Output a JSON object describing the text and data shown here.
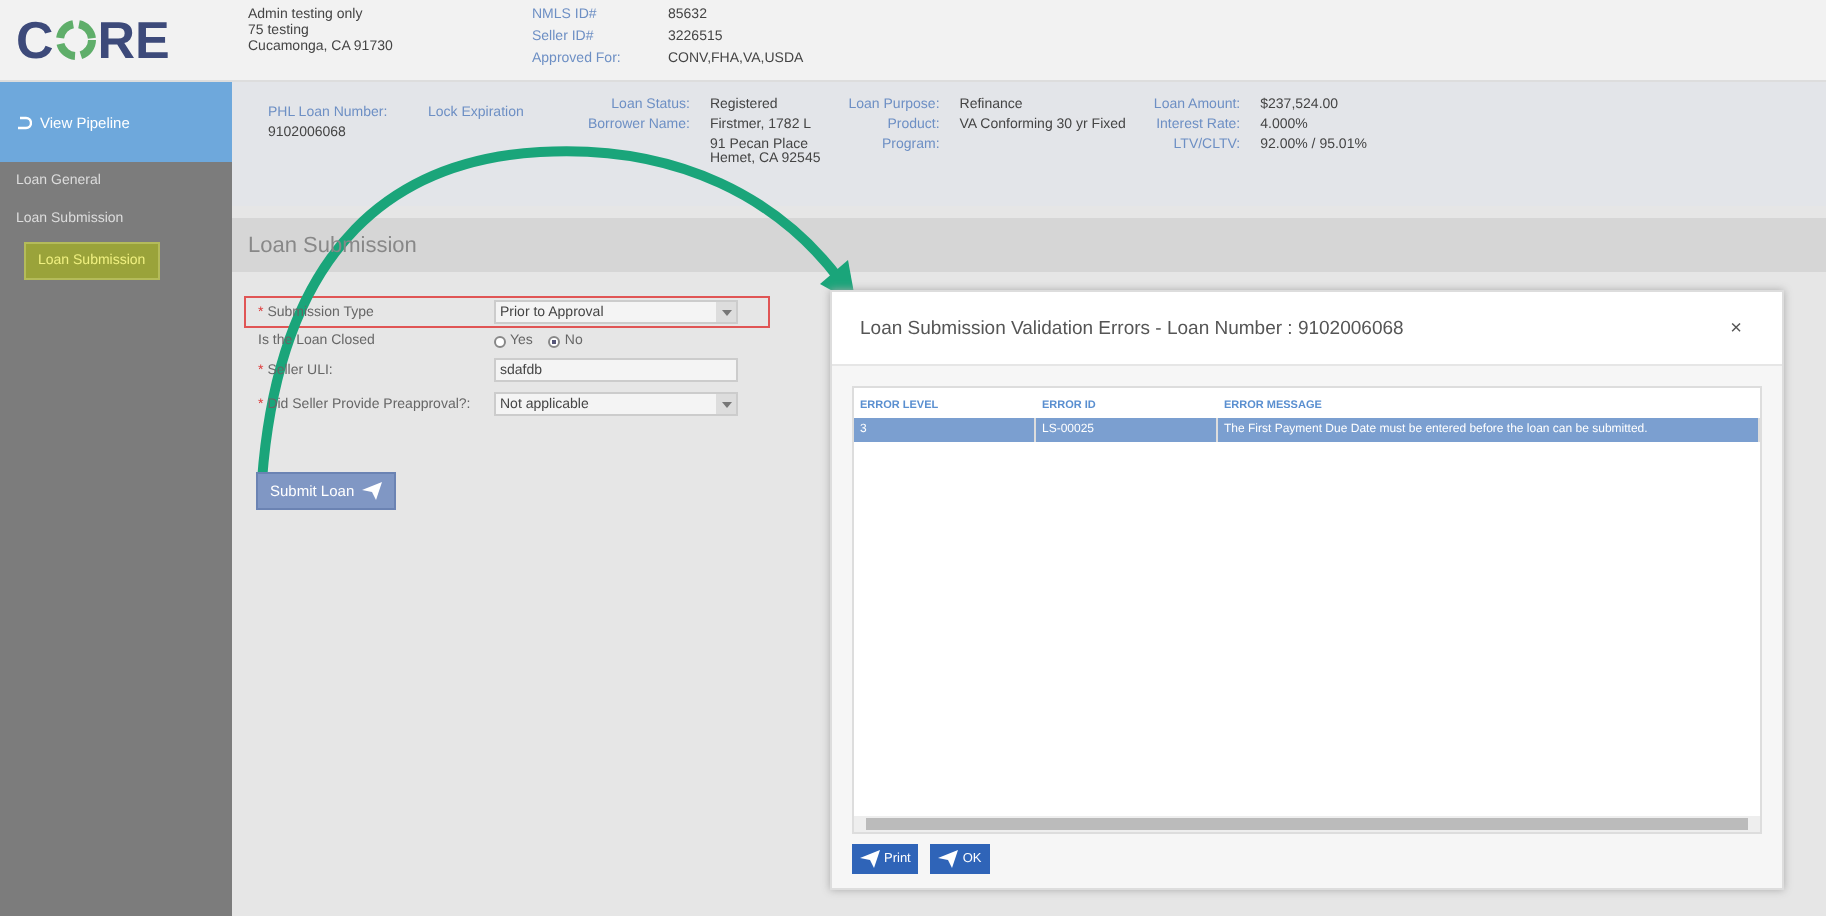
{
  "logo": {
    "before": "C",
    "after": "RE"
  },
  "org_lines": [
    "Admin testing only",
    "75 testing",
    "Cucamonga, CA 91730"
  ],
  "ids": [
    {
      "label": "NMLS ID#",
      "value": "85632"
    },
    {
      "label": "Seller ID#",
      "value": "3226515"
    },
    {
      "label": "Approved For:",
      "value": "CONV,FHA,VA,USDA"
    }
  ],
  "sidebar": {
    "back": "View Pipeline",
    "items": [
      {
        "label": "Loan General",
        "selected": false
      },
      {
        "label": "Loan Submission",
        "selected": false,
        "children": [
          {
            "label": "Loan Submission",
            "selected": true
          }
        ]
      }
    ]
  },
  "loan_summary": {
    "stacked": [
      {
        "label": "PHL Loan Number:",
        "value": "9102006068"
      },
      {
        "label": "Lock Expiration"
      }
    ],
    "columns": [
      [
        {
          "label": "Loan Status:",
          "value": "Registered"
        },
        {
          "label": "Borrower Name:",
          "value": "Firstmer, 1782 L"
        },
        {
          "value": "91 Pecan Place\nHemet, CA 92545"
        }
      ],
      [
        {
          "label": "Loan Purpose:",
          "value": "Refinance"
        },
        {
          "label": "Product:",
          "value": "VA Conforming 30 yr Fixed"
        },
        {
          "label": "Program:"
        }
      ],
      [
        {
          "label": "Loan Amount:",
          "value": "$237,524.00"
        },
        {
          "label": "Interest Rate:",
          "value": "4.000%"
        },
        {
          "label": "LTV/CLTV:",
          "value": "92.00% / 95.01%"
        }
      ]
    ]
  },
  "section_title": "Loan Submission",
  "required_mark": "*",
  "form": [
    {
      "kind": "select",
      "label": "Submission Type",
      "value": "Prior to Approval",
      "highlighted": true,
      "required": true
    },
    {
      "kind": "radio",
      "label": "Is the Loan Closed",
      "options": [
        {
          "label": "Yes",
          "selected": false
        },
        {
          "label": "No",
          "selected": true
        }
      ]
    },
    {
      "kind": "text",
      "label": "Seller ULI:",
      "value": "sdafdb",
      "required": true
    },
    {
      "kind": "select",
      "label": "Did Seller Provide Preapproval?:",
      "value": "Not applicable",
      "required": true
    }
  ],
  "submit_button": "Submit Loan",
  "dialog": {
    "title": "Loan Submission Validation Errors - Loan Number : 9102006068",
    "close": "×",
    "columns": [
      "ERROR LEVEL",
      "ERROR ID",
      "ERROR MESSAGE"
    ],
    "rows": [
      {
        "cells": [
          "3",
          "LS-00025",
          "The First Payment Due Date must be entered before the loan can be submitted."
        ],
        "selected": true
      }
    ],
    "buttons": [
      "Print",
      "OK"
    ]
  }
}
